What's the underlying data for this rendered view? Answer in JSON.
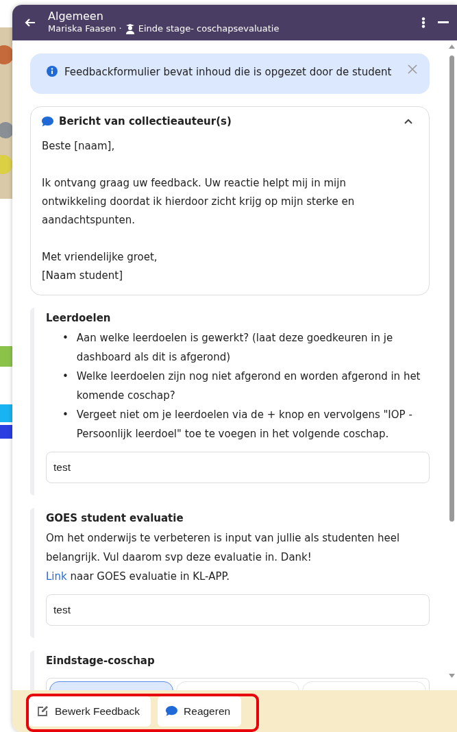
{
  "header": {
    "title": "Algemeen",
    "author": "Mariska Faasen",
    "separator": "·",
    "form_name": "Einde stage- coschapsevaluatie"
  },
  "alert": {
    "text": "Feedbackformulier bevat inhoud die is opgezet door de student"
  },
  "message": {
    "title": "Bericht van collectieauteur(s)",
    "expanded": true,
    "paragraphs": [
      "Beste [naam],",
      "Ik ontvang graag uw feedback. Uw reactie helpt mij in mijn ontwikkeling doordat ik hierdoor zicht krijg op mijn sterke en aandachtspunten.",
      "Met vriendelijke groet,\n[Naam student]"
    ]
  },
  "sections": [
    {
      "kind": "text",
      "title": "Leerdoelen",
      "marker": "•",
      "bullets": [
        "Aan welke leerdoelen is gewerkt? (laat deze goedkeuren in je dashboard als dit is afgerond)",
        "Welke leerdoelen zijn nog niet afgerond en worden afgerond in het komende coschap?",
        "Vergeet niet om je leerdoelen via de + knop  en vervolgens \"IOP - Persoonlijk leerdoel\" toe te voegen in het volgende coschap."
      ],
      "value": "test"
    },
    {
      "kind": "text",
      "title": "GOES student evaluatie",
      "description": "Om het onderwijs te verbeteren is input van jullie als studenten heel belangrijk. Vul daarom svp deze evaluatie in. Dank!",
      "link": "Link",
      "link_suffix": "naar GOES evaluatie in KL-APP.",
      "value": "test"
    },
    {
      "kind": "choice",
      "title": "Eindstage-coschap",
      "options": [
        {
          "selected": true
        },
        {
          "selected": false
        },
        {
          "selected": false
        }
      ]
    }
  ],
  "footer": {
    "buttons": [
      {
        "kind": "edit",
        "label": "Bewerk Feedback"
      },
      {
        "kind": "comment",
        "label": "Reageren"
      }
    ]
  }
}
